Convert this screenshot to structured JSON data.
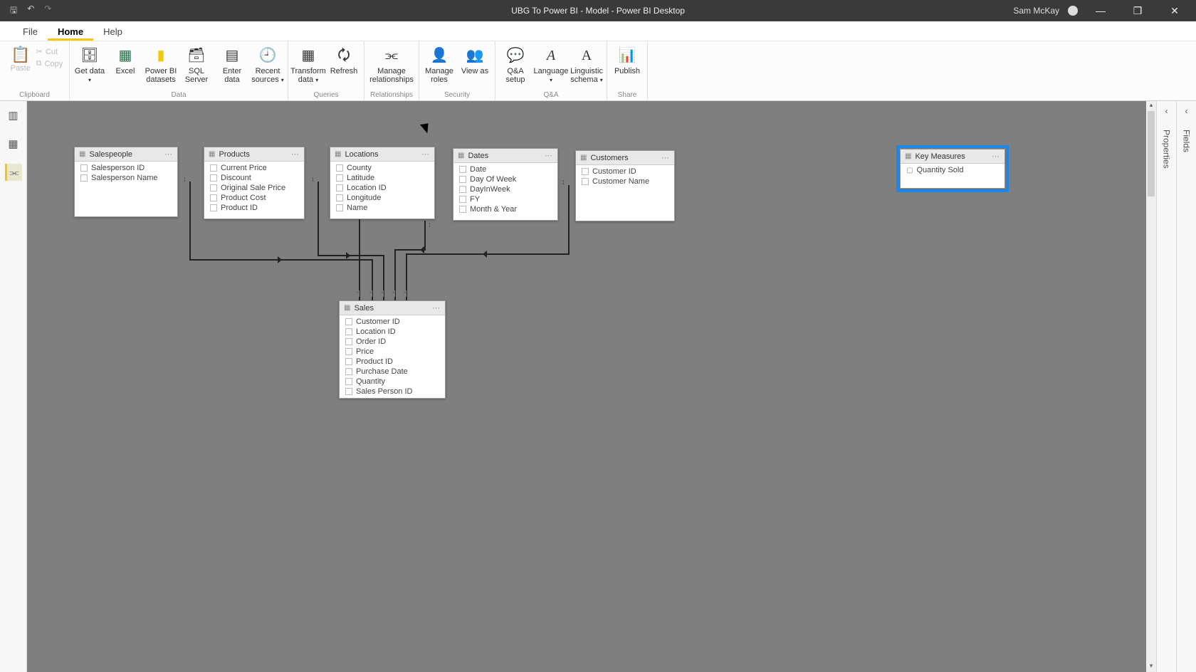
{
  "titlebar": {
    "title": "UBG To Power BI - Model - Power BI Desktop",
    "user": "Sam McKay"
  },
  "menu": {
    "file": "File",
    "home": "Home",
    "help": "Help"
  },
  "ribbon": {
    "clipboard": {
      "paste": "Paste",
      "cut": "Cut",
      "copy": "Copy",
      "group": "Clipboard"
    },
    "data": {
      "get": "Get data",
      "excel": "Excel",
      "pbi": "Power BI datasets",
      "sql": "SQL Server",
      "enter": "Enter data",
      "recent": "Recent sources",
      "group": "Data"
    },
    "queries": {
      "transform": "Transform data",
      "refresh": "Refresh",
      "group": "Queries"
    },
    "relationships": {
      "manage": "Manage relationships",
      "group": "Relationships"
    },
    "security": {
      "roles": "Manage roles",
      "viewas": "View as",
      "group": "Security"
    },
    "qa": {
      "setup": "Q&A setup",
      "language": "Language",
      "schema": "Linguistic schema",
      "group": "Q&A"
    },
    "share": {
      "publish": "Publish",
      "group": "Share"
    }
  },
  "panes": {
    "properties": "Properties",
    "fields": "Fields"
  },
  "tables": {
    "salespeople": {
      "name": "Salespeople",
      "fields": [
        "Salesperson ID",
        "Salesperson Name"
      ]
    },
    "products": {
      "name": "Products",
      "fields": [
        "Current Price",
        "Discount",
        "Original Sale Price",
        "Product Cost",
        "Product ID"
      ]
    },
    "locations": {
      "name": "Locations",
      "fields": [
        "County",
        "Latitude",
        "Location ID",
        "Longitude",
        "Name"
      ]
    },
    "dates": {
      "name": "Dates",
      "fields": [
        "Date",
        "Day Of Week",
        "DayInWeek",
        "FY",
        "Month & Year"
      ]
    },
    "customers": {
      "name": "Customers",
      "fields": [
        "Customer ID",
        "Customer Name"
      ]
    },
    "keymeasures": {
      "name": "Key Measures",
      "fields": [
        "Quantity Sold"
      ]
    },
    "sales": {
      "name": "Sales",
      "fields": [
        "Customer ID",
        "Location ID",
        "Order ID",
        "Price",
        "Product ID",
        "Purchase Date",
        "Quantity",
        "Sales Person ID"
      ]
    }
  },
  "cardinality": {
    "one": "1",
    "many": "*"
  }
}
